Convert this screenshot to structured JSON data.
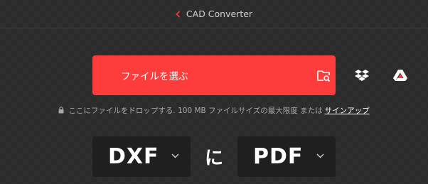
{
  "header": {
    "back_icon": "chevron-left-icon",
    "title": "CAD Converter",
    "accent": "#ff3c3c"
  },
  "uploader": {
    "choose_label": "ファイルを選ぶ",
    "sources": [
      {
        "icon": "device-search-icon"
      },
      {
        "icon": "dropbox-icon"
      },
      {
        "icon": "google-drive-icon"
      }
    ],
    "background": "#ff3c3c"
  },
  "note": {
    "lock_icon": "lock-icon",
    "text": "ここにファイルをドロップする. 100 MB ファイルサイズの最大限度 または",
    "link": "サインアップ"
  },
  "conversion": {
    "from": "DXF",
    "connector": "に",
    "to": "PDF"
  }
}
